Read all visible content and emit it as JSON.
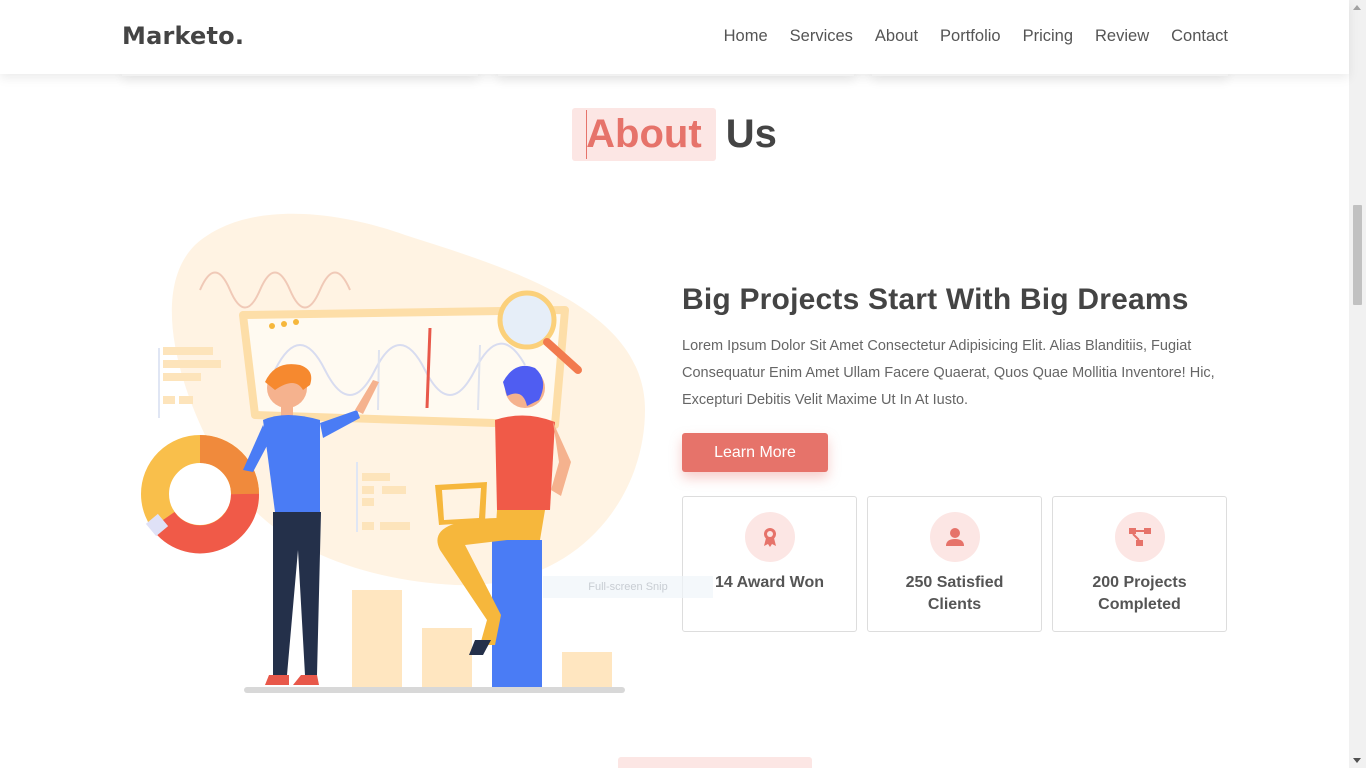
{
  "brand": {
    "logo": "Marketo."
  },
  "nav": {
    "items": [
      "Home",
      "Services",
      "About",
      "Portfolio",
      "Pricing",
      "Review",
      "Contact"
    ]
  },
  "section": {
    "title_highlight": "About",
    "title_rest": "Us"
  },
  "about": {
    "heading": "Big Projects Start With Big Dreams",
    "body": "Lorem Ipsum Dolor Sit Amet Consectetur Adipisicing Elit. Alias Blanditiis, Fugiat Consequatur Enim Amet Ullam Facere Quaerat, Quos Quae Mollitia Inventore! Hic, Excepturi Debitis Velit Maxime Ut In At Iusto.",
    "button_label": "Learn More"
  },
  "stats": [
    {
      "icon": "award-icon",
      "label": "14 Award Won"
    },
    {
      "icon": "user-icon",
      "label": "250 Satisfied Clients"
    },
    {
      "icon": "project-icon",
      "label": "200 Projects Completed"
    }
  ],
  "overlay": {
    "snip_text": "Full-screen Snip"
  },
  "colors": {
    "accent": "#e6736a",
    "accent_light": "#fce6e4",
    "text_dark": "#444444"
  }
}
